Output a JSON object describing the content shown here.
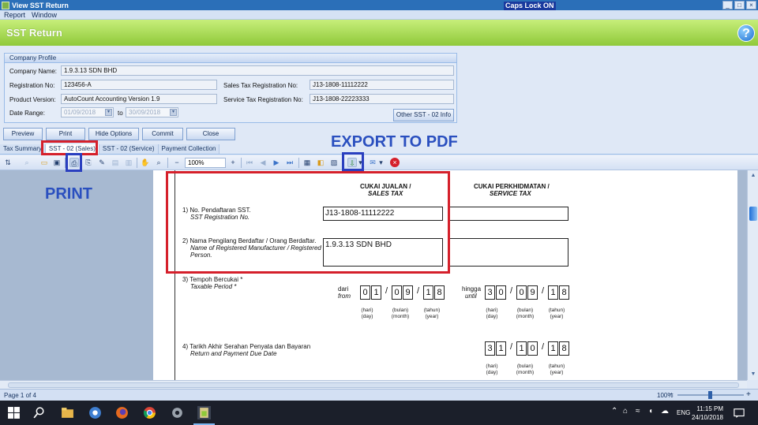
{
  "window": {
    "title": "View SST Return",
    "caps_lock": "Caps Lock ON",
    "min": "_",
    "max": "□",
    "close": "×"
  },
  "menu": [
    "Report",
    "Window"
  ],
  "header": {
    "title": "SST Return",
    "help": "?"
  },
  "company_profile": {
    "title": "Company Profile",
    "company_name_label": "Company Name:",
    "company_name": "1.9.3.13 SDN BHD",
    "registration_label": "Registration No:",
    "registration": "123456-A",
    "product_label": "Product Version:",
    "product": "AutoCount Accounting Version 1.9",
    "date_range_label": "Date Range:",
    "date_from": "01/09/2018",
    "to_label": "to",
    "date_to": "30/09/2018",
    "sales_tax_label": "Sales Tax Registration No:",
    "sales_tax": "J13-1808-11112222",
    "service_tax_label": "Service Tax Registration No:",
    "service_tax": "J13-1808-22223333",
    "other_button": "Other SST - 02 Info"
  },
  "actions": [
    "Preview",
    "Print",
    "Hide Options",
    "Commit",
    "Close"
  ],
  "tabs": [
    "Tax Summary",
    "SST - 02 (Sales)",
    "SST - 02 (Service)",
    "Payment Collection"
  ],
  "toolbar": {
    "zoom": "100%"
  },
  "annotations": {
    "export": "EXPORT TO PDF",
    "print": "PRINT"
  },
  "form": {
    "col_sales_1": "CUKAI JUALAN /",
    "col_sales_2": "SALES TAX",
    "col_service_1": "CUKAI PERKHIDMATAN /",
    "col_service_2": "SERVICE TAX",
    "q1_1": "1) No. Pendaftaran SST.",
    "q1_2": "SST Registration No.",
    "q1_value": "J13-1808-11112222",
    "q2_1": "2) Nama Pengilang Berdaftar / Orang Berdaftar.",
    "q2_2": "Name of Registered Manufacturer / Registered",
    "q2_3": "Person.",
    "q2_value": "1.9.3.13 SDN BHD",
    "q3_1": "3) Tempoh Bercukai *",
    "q3_2": "Taxable Period *",
    "from_1": "dari",
    "from_2": "from",
    "until_1": "hingga",
    "until_2": "until",
    "from_digits": [
      "0",
      "1",
      "0",
      "9",
      "1",
      "8"
    ],
    "until_digits": [
      "3",
      "0",
      "0",
      "9",
      "1",
      "8"
    ],
    "q4_1": "4) Tarikh Akhir Serahan Penyata dan Bayaran",
    "q4_2": "Return and Payment Due Date",
    "due_digits": [
      "3",
      "1",
      "1",
      "0",
      "1",
      "8"
    ],
    "day_1": "(hari)",
    "day_2": "(day)",
    "month_1": "(bulan)",
    "month_2": "(month)",
    "year_1": "(tahun)",
    "year_2": "(year)"
  },
  "status": {
    "page": "Page 1 of 4",
    "zoom": "100%"
  },
  "taskbar": {
    "lang": "ENG",
    "time": "11:15 PM",
    "date": "24/10/2018"
  },
  "colors": {
    "accent_green": "#8fc93a",
    "annotation_red": "#d5202b",
    "annotation_blue": "#2a3fbf"
  }
}
